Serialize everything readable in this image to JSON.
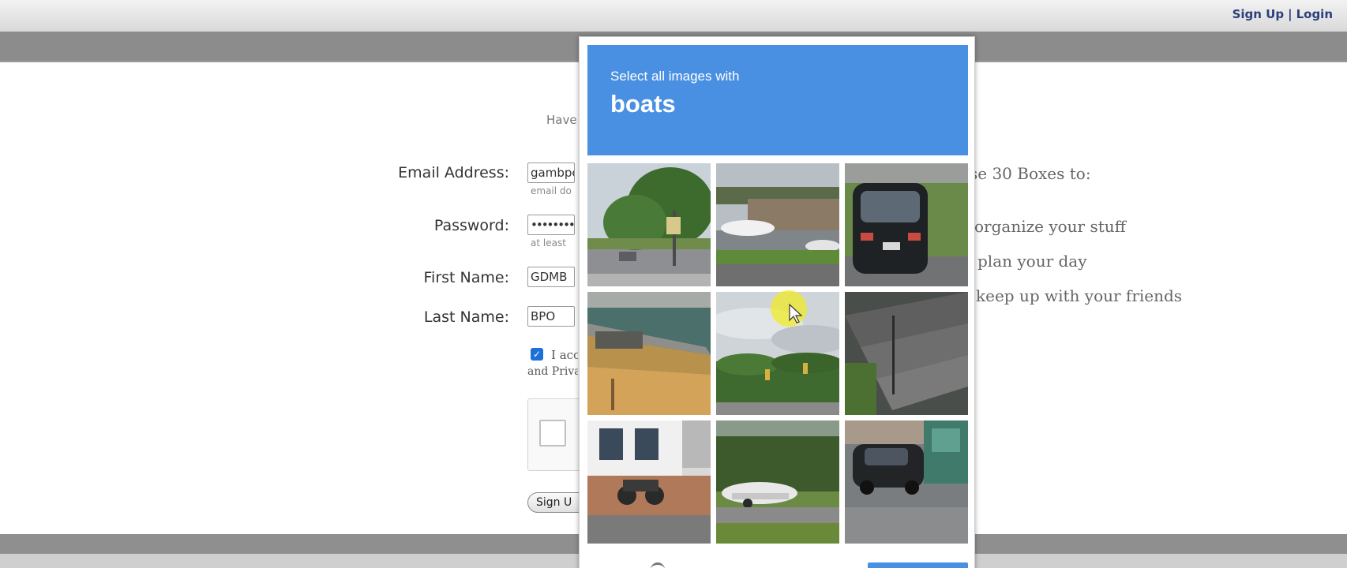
{
  "header": {
    "links": [
      {
        "label": "Sign Up"
      },
      {
        "label": "Login"
      }
    ],
    "separator": "|"
  },
  "form": {
    "have_account_text": "Have",
    "email": {
      "label": "Email Address:",
      "value": "gambpc",
      "hint": "email do"
    },
    "password": {
      "label": "Password:",
      "value": "•••••••••••",
      "hint": "at least"
    },
    "first_name": {
      "label": "First Name:",
      "value": "GDMB"
    },
    "last_name": {
      "label": "Last Name:",
      "value": "BPO"
    },
    "terms": {
      "checked": true,
      "line1": "I acc",
      "line2": "and Priva"
    },
    "signup_button": "Sign U"
  },
  "promo": {
    "heading": "se 30 Boxes to:",
    "items": [
      "organize your stuff",
      "plan your day",
      "keep up with your friends"
    ]
  },
  "captcha": {
    "instruction": "Select all images with",
    "target": "boats",
    "accent_color": "#4a90e2",
    "tiles": [
      {
        "scene": "street with trees and sign"
      },
      {
        "scene": "boats on trailers near building"
      },
      {
        "scene": "black car parked on street"
      },
      {
        "scene": "boat deck over water"
      },
      {
        "scene": "sky with treeline and traffic lights"
      },
      {
        "scene": "outdoor concrete stairs"
      },
      {
        "scene": "storefront with motorcycle"
      },
      {
        "scene": "boat on trailer in road"
      },
      {
        "scene": "car in parking lot near building"
      }
    ]
  }
}
